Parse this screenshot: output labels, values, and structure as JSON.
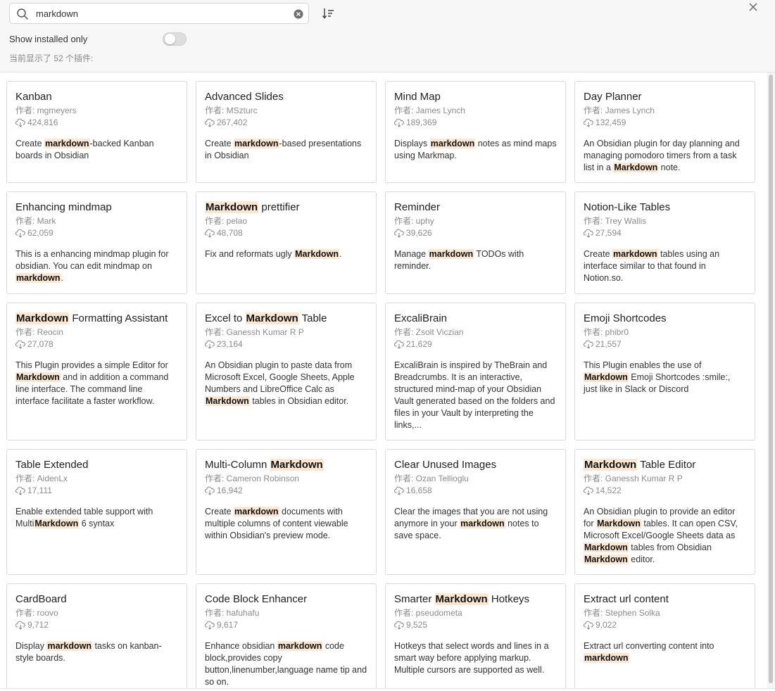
{
  "search": {
    "query": "markdown"
  },
  "icons": {
    "search": "search-icon",
    "clear": "clear-circle-icon",
    "sort": "sort-icon",
    "close": "close-icon",
    "download": "download-icon"
  },
  "filters": {
    "installed_only_label": "Show installed only",
    "installed_only_on": false
  },
  "count_label": "当前显示了 52 个插件:",
  "accent": "#fbe7d2",
  "plugins": [
    {
      "name": [
        {
          "t": "Kanban"
        }
      ],
      "author": "作者: mgmeyers",
      "downloads": "424,816",
      "desc": [
        {
          "t": "Create "
        },
        {
          "t": "markdown",
          "h": true
        },
        {
          "t": "-backed Kanban boards in Obsidian"
        }
      ]
    },
    {
      "name": [
        {
          "t": "Advanced Slides"
        }
      ],
      "author": "作者: MSzturc",
      "downloads": "267,402",
      "desc": [
        {
          "t": "Create "
        },
        {
          "t": "markdown",
          "h": true
        },
        {
          "t": "-based presentations in Obsidian"
        }
      ]
    },
    {
      "name": [
        {
          "t": "Mind Map"
        }
      ],
      "author": "作者: James Lynch",
      "downloads": "189,369",
      "desc": [
        {
          "t": "Displays "
        },
        {
          "t": "markdown",
          "h": true
        },
        {
          "t": " notes as mind maps using Markmap."
        }
      ]
    },
    {
      "name": [
        {
          "t": "Day Planner"
        }
      ],
      "author": "作者: James Lynch",
      "downloads": "132,459",
      "desc": [
        {
          "t": "An Obsidian plugin for day planning and managing pomodoro timers from a task list in a "
        },
        {
          "t": "Markdown",
          "h": true
        },
        {
          "t": " note."
        }
      ]
    },
    {
      "name": [
        {
          "t": "Enhancing mindmap"
        }
      ],
      "author": "作者: Mark",
      "downloads": "62,059",
      "desc": [
        {
          "t": "This is a enhancing mindmap plugin for obsidian. You can edit mindmap on "
        },
        {
          "t": "markdown",
          "h": true
        },
        {
          "t": "."
        }
      ]
    },
    {
      "name": [
        {
          "t": "Markdown",
          "h": true
        },
        {
          "t": " prettifier"
        }
      ],
      "author": "作者: pelao",
      "downloads": "48,708",
      "desc": [
        {
          "t": "Fix and reformats ugly "
        },
        {
          "t": "Markdown",
          "h": true
        },
        {
          "t": "."
        }
      ]
    },
    {
      "name": [
        {
          "t": "Reminder"
        }
      ],
      "author": "作者: uphy",
      "downloads": "39,626",
      "desc": [
        {
          "t": "Manage "
        },
        {
          "t": "markdown",
          "h": true
        },
        {
          "t": " TODOs with reminder."
        }
      ]
    },
    {
      "name": [
        {
          "t": "Notion-Like Tables"
        }
      ],
      "author": "作者: Trey Wallis",
      "downloads": "27,594",
      "desc": [
        {
          "t": "Create "
        },
        {
          "t": "markdown",
          "h": true
        },
        {
          "t": " tables using an interface similar to that found in Notion.so."
        }
      ]
    },
    {
      "name": [
        {
          "t": "Markdown",
          "h": true
        },
        {
          "t": " Formatting Assistant"
        }
      ],
      "author": "作者: Reocin",
      "downloads": "27,078",
      "desc": [
        {
          "t": "This Plugin provides a simple Editor for "
        },
        {
          "t": "Markdown",
          "h": true
        },
        {
          "t": " and in addition a command line interface. The command line interface facilitate a faster workflow."
        }
      ]
    },
    {
      "name": [
        {
          "t": "Excel to "
        },
        {
          "t": "Markdown",
          "h": true
        },
        {
          "t": " Table"
        }
      ],
      "author": "作者: Ganessh Kumar R P",
      "downloads": "23,164",
      "desc": [
        {
          "t": "An Obsidian plugin to paste data from Microsoft Excel, Google Sheets, Apple Numbers and LibreOffice Calc as "
        },
        {
          "t": "Markdown",
          "h": true
        },
        {
          "t": " tables in Obsidian editor."
        }
      ]
    },
    {
      "name": [
        {
          "t": "ExcaliBrain"
        }
      ],
      "author": "作者: Zsolt Viczian",
      "downloads": "21,629",
      "desc": [
        {
          "t": "ExcaliBrain is inspired by TheBrain and Breadcrumbs. It is an interactive, structured mind-map of your Obsidian Vault generated based on the folders and files in your Vault by interpreting the links,..."
        }
      ]
    },
    {
      "name": [
        {
          "t": "Emoji Shortcodes"
        }
      ],
      "author": "作者: phibr0",
      "downloads": "21,557",
      "desc": [
        {
          "t": "This Plugin enables the use of "
        },
        {
          "t": "Markdown",
          "h": true
        },
        {
          "t": " Emoji Shortcodes :smile:, just like in Slack or Discord"
        }
      ]
    },
    {
      "name": [
        {
          "t": "Table Extended"
        }
      ],
      "author": "作者: AidenLx",
      "downloads": "17,111",
      "desc": [
        {
          "t": "Enable extended table support with Multi"
        },
        {
          "t": "Markdown",
          "h": true
        },
        {
          "t": " 6 syntax"
        }
      ]
    },
    {
      "name": [
        {
          "t": "Multi-Column "
        },
        {
          "t": "Markdown",
          "h": true
        }
      ],
      "author": "作者: Cameron Robinson",
      "downloads": "16,942",
      "desc": [
        {
          "t": "Create "
        },
        {
          "t": "markdown",
          "h": true
        },
        {
          "t": " documents with multiple columns of content viewable within Obsidian's preview mode."
        }
      ]
    },
    {
      "name": [
        {
          "t": "Clear Unused Images"
        }
      ],
      "author": "作者: Ozan Tellioglu",
      "downloads": "16,658",
      "desc": [
        {
          "t": "Clear the images that you are not using anymore in your "
        },
        {
          "t": "markdown",
          "h": true
        },
        {
          "t": " notes to save space."
        }
      ]
    },
    {
      "name": [
        {
          "t": "Markdown",
          "h": true
        },
        {
          "t": " Table Editor"
        }
      ],
      "author": "作者: Ganessh Kumar R P",
      "downloads": "14,522",
      "desc": [
        {
          "t": "An Obsidian plugin to provide an editor for "
        },
        {
          "t": "Markdown",
          "h": true
        },
        {
          "t": " tables. It can open CSV, Microsoft Excel/Google Sheets data as "
        },
        {
          "t": "Markdown",
          "h": true
        },
        {
          "t": " tables from Obsidian "
        },
        {
          "t": "Markdown",
          "h": true
        },
        {
          "t": " editor."
        }
      ]
    },
    {
      "name": [
        {
          "t": "CardBoard"
        }
      ],
      "author": "作者: roovo",
      "downloads": "9,712",
      "desc": [
        {
          "t": "Display "
        },
        {
          "t": "markdown",
          "h": true
        },
        {
          "t": " tasks on kanban-style boards."
        }
      ]
    },
    {
      "name": [
        {
          "t": "Code Block Enhancer"
        }
      ],
      "author": "作者: hafuhafu",
      "downloads": "9,617",
      "desc": [
        {
          "t": "Enhance obsidian "
        },
        {
          "t": "markdown",
          "h": true
        },
        {
          "t": " code block,provides copy button,linenumber,language name tip and so on."
        }
      ]
    },
    {
      "name": [
        {
          "t": "Smarter "
        },
        {
          "t": "Markdown",
          "h": true
        },
        {
          "t": " Hotkeys"
        }
      ],
      "author": "作者: pseudometa",
      "downloads": "9,525",
      "desc": [
        {
          "t": "Hotkeys that select words and lines in a smart way before applying markup. Multiple cursors are supported as well."
        }
      ]
    },
    {
      "name": [
        {
          "t": "Extract url content"
        }
      ],
      "author": "作者: Stephen Solka",
      "downloads": "9,022",
      "desc": [
        {
          "t": "Extract url converting content into "
        },
        {
          "t": "markdown",
          "h": true
        }
      ]
    }
  ]
}
